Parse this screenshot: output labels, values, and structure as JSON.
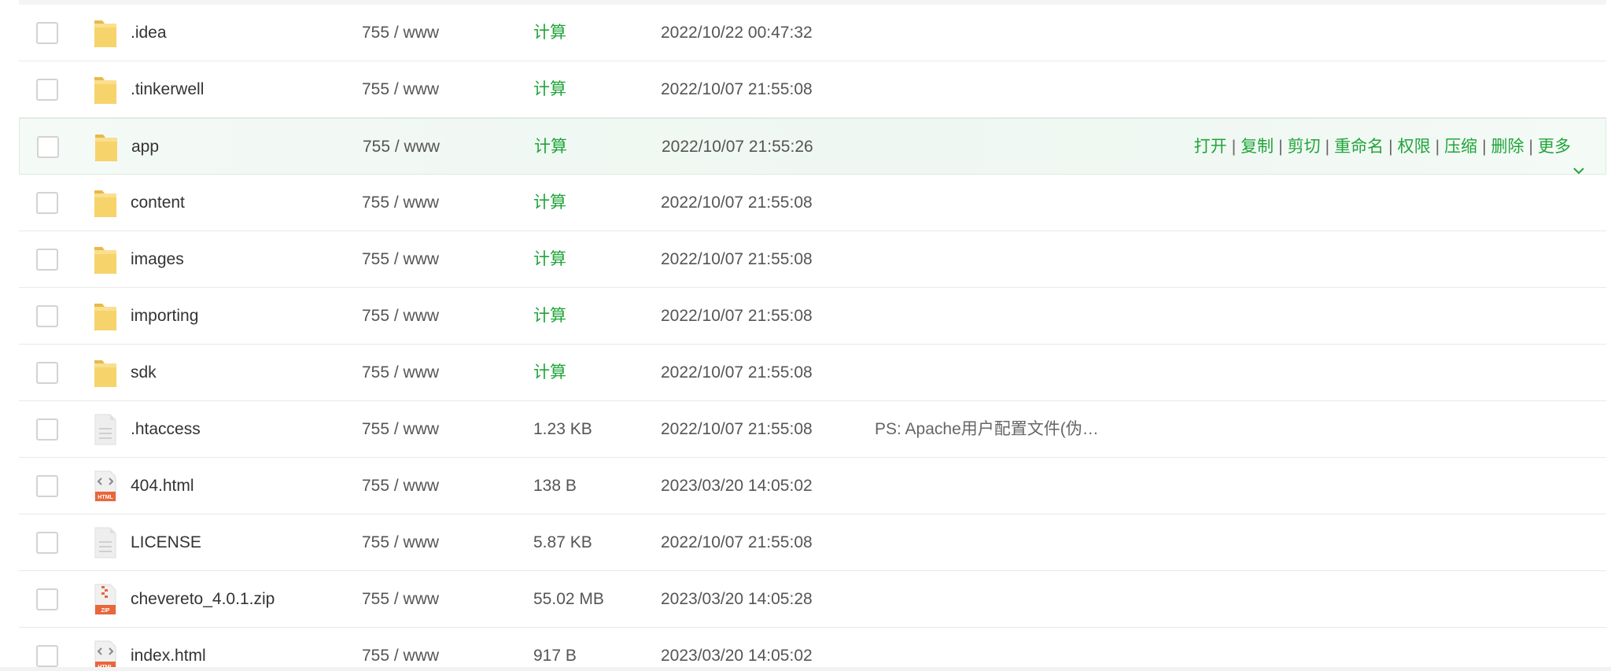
{
  "file_list": {
    "rows": [
      {
        "name": ".idea",
        "icon": "folder-icon",
        "perm": "755 / www",
        "size": "计算",
        "size_is_action": true,
        "mtime": "2022/10/22 00:47:32",
        "ps": ""
      },
      {
        "name": ".tinkerwell",
        "icon": "folder-icon",
        "perm": "755 / www",
        "size": "计算",
        "size_is_action": true,
        "mtime": "2022/10/07 21:55:08",
        "ps": ""
      },
      {
        "name": "app",
        "icon": "folder-icon",
        "perm": "755 / www",
        "size": "计算",
        "size_is_action": true,
        "mtime": "2022/10/07 21:55:26",
        "ps": "",
        "hovered": true
      },
      {
        "name": "content",
        "icon": "folder-icon",
        "perm": "755 / www",
        "size": "计算",
        "size_is_action": true,
        "mtime": "2022/10/07 21:55:08",
        "ps": ""
      },
      {
        "name": "images",
        "icon": "folder-icon",
        "perm": "755 / www",
        "size": "计算",
        "size_is_action": true,
        "mtime": "2022/10/07 21:55:08",
        "ps": ""
      },
      {
        "name": "importing",
        "icon": "folder-icon",
        "perm": "755 / www",
        "size": "计算",
        "size_is_action": true,
        "mtime": "2022/10/07 21:55:08",
        "ps": ""
      },
      {
        "name": "sdk",
        "icon": "folder-icon",
        "perm": "755 / www",
        "size": "计算",
        "size_is_action": true,
        "mtime": "2022/10/07 21:55:08",
        "ps": ""
      },
      {
        "name": ".htaccess",
        "icon": "text-file-icon",
        "perm": "755 / www",
        "size": "1.23 KB",
        "size_is_action": false,
        "mtime": "2022/10/07 21:55:08",
        "ps": "PS: Apache用户配置文件(伪…"
      },
      {
        "name": "404.html",
        "icon": "html-file-icon",
        "perm": "755 / www",
        "size": "138 B",
        "size_is_action": false,
        "mtime": "2023/03/20 14:05:02",
        "ps": ""
      },
      {
        "name": "LICENSE",
        "icon": "text-file-icon",
        "perm": "755 / www",
        "size": "5.87 KB",
        "size_is_action": false,
        "mtime": "2022/10/07 21:55:08",
        "ps": ""
      },
      {
        "name": "chevereto_4.0.1.zip",
        "icon": "zip-file-icon",
        "perm": "755 / www",
        "size": "55.02 MB",
        "size_is_action": false,
        "mtime": "2023/03/20 14:05:28",
        "ps": ""
      },
      {
        "name": "index.html",
        "icon": "html-file-icon",
        "perm": "755 / www",
        "size": "917 B",
        "size_is_action": false,
        "mtime": "2023/03/20 14:05:02",
        "ps": ""
      }
    ],
    "row_actions": [
      "打开",
      "复制",
      "剪切",
      "重命名",
      "权限",
      "压缩",
      "删除",
      "更多"
    ],
    "icon_labels": {
      "html": "HTML",
      "zip": "ZIP"
    },
    "colors": {
      "accent": "#20a53a",
      "folder": "#f7d36b",
      "hover_row": "#eef7f1",
      "html_badge": "#e9663a",
      "zip_badge": "#e9663a"
    }
  }
}
